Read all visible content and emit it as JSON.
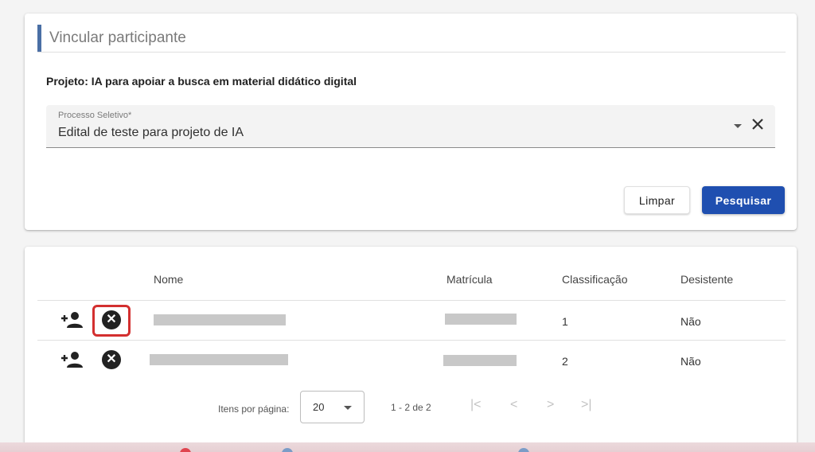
{
  "form": {
    "title": "Vincular participante",
    "projeto_label": "Projeto:",
    "projeto_value": "IA para apoiar a busca em material didático digital",
    "processo_label": "Processo Seletivo*",
    "processo_value": "Edital de teste para projeto de IA",
    "clear_icon": "close-icon",
    "limpar_label": "Limpar",
    "pesquisar_label": "Pesquisar"
  },
  "colors": {
    "accent": "#1f4fb0",
    "title_bar": "#4a6fa5",
    "highlight": "#d32f2f"
  },
  "table": {
    "headers": {
      "nome": "Nome",
      "matricula": "Matrícula",
      "classificacao": "Classificação",
      "desistente": "Desistente"
    },
    "rows": [
      {
        "classificacao": "1",
        "desistente": "Não",
        "nome_redacted": true,
        "matricula_redacted": true
      },
      {
        "classificacao": "2",
        "desistente": "Não",
        "nome_redacted": true,
        "matricula_redacted": true
      }
    ],
    "row_icons": [
      "person-add-icon",
      "cancel-icon"
    ]
  },
  "pagination": {
    "items_per_page_label": "Itens por página:",
    "items_per_page_value": "20",
    "range": "1 - 2 de 2",
    "first": "|<",
    "prev": "<",
    "next": ">",
    "last": ">|"
  }
}
